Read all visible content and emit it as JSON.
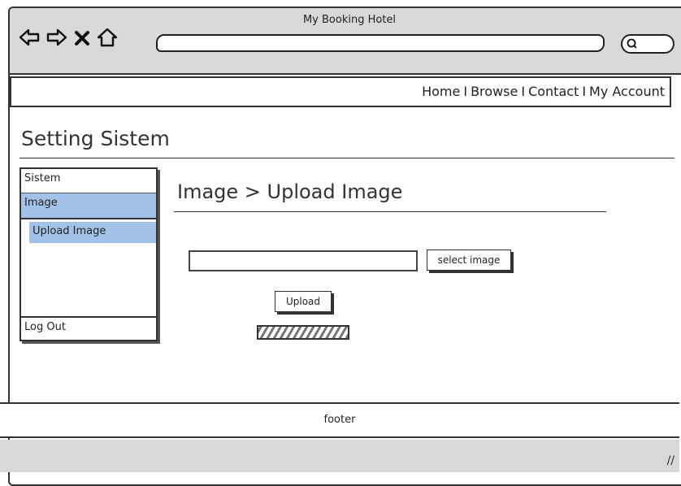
{
  "window": {
    "title": "My Booking Hotel"
  },
  "browser_controls": {
    "back_icon": "arrow-left-icon",
    "forward_icon": "arrow-right-icon",
    "stop_icon": "close-icon",
    "home_icon": "home-icon",
    "search_icon": "search-icon",
    "address_value": ""
  },
  "topnav": {
    "items": [
      "Home",
      "Browse",
      "Contact",
      "My Account"
    ],
    "separator": "I"
  },
  "page": {
    "title": "Setting Sistem"
  },
  "sidebar": {
    "items": [
      {
        "label": "Sistem",
        "selected": false
      },
      {
        "label": "Image",
        "selected": true
      },
      {
        "label": "Upload Image",
        "selected": true
      },
      {
        "label": "Log Out",
        "selected": false
      }
    ]
  },
  "main": {
    "breadcrumb": "Image > Upload Image",
    "file_value": "",
    "select_label": "select image",
    "upload_label": "Upload",
    "progress": 1.0
  },
  "footer": {
    "label": "footer"
  },
  "colors": {
    "selected": "#a3c2e8",
    "chrome": "#d9d9d9"
  }
}
